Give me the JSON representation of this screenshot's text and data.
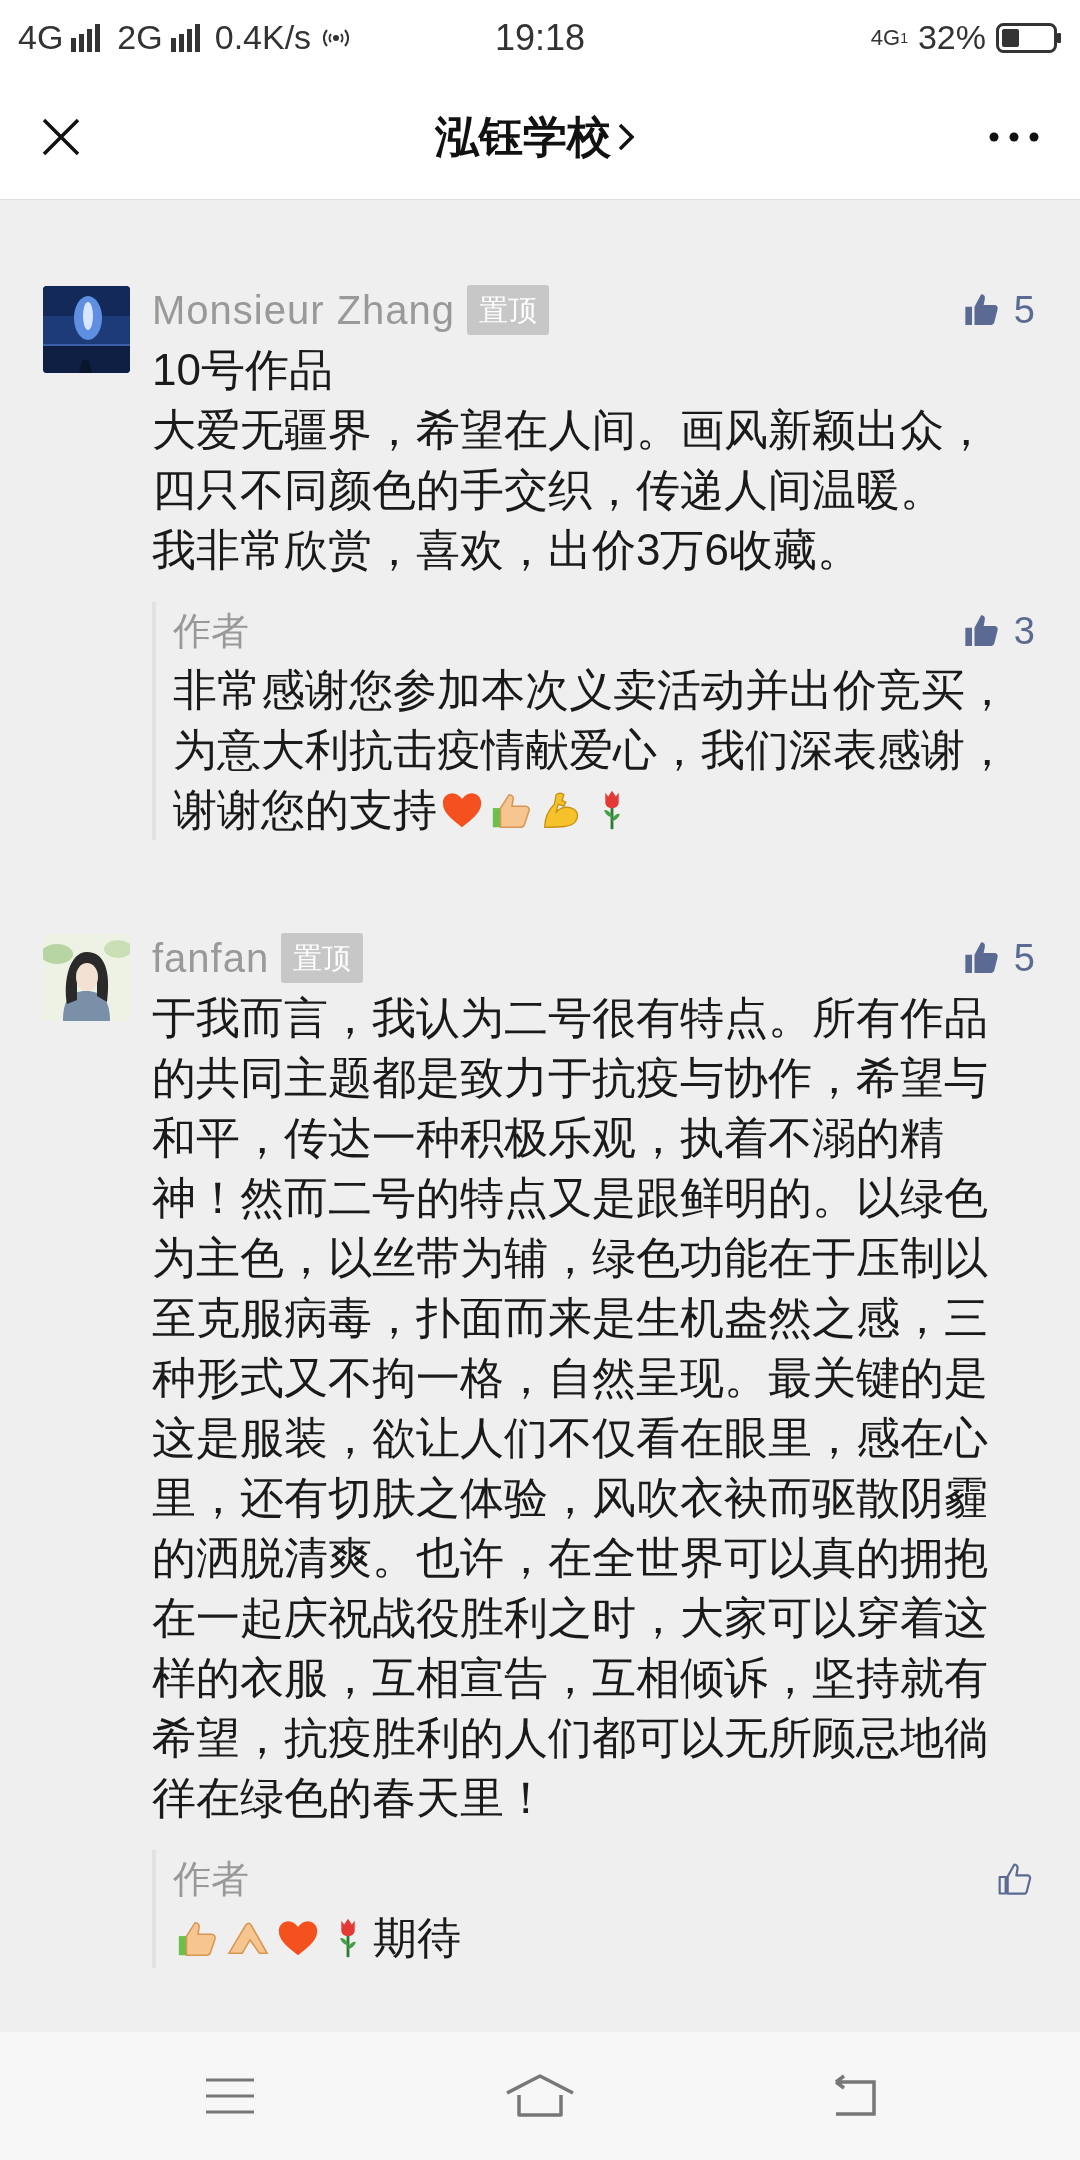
{
  "status_bar": {
    "network_1": "4G",
    "network_2": "2G",
    "speed": "0.4K/s",
    "time": "19:18",
    "network_right": "4G",
    "sim": "1",
    "battery": "32%"
  },
  "nav": {
    "title": "泓钰学校"
  },
  "comments": [
    {
      "name": "Monsieur Zhang",
      "badge": "置顶",
      "likes": "5",
      "liked": true,
      "avatar": {
        "kind": "picture"
      },
      "lines": [
        "10号作品",
        "大爱无疆界，希望在人间。画风新颖出众，",
        "四只不同颜色的手交织，传递人间温暖。",
        "我非常欣赏，喜欢，出价3万6收藏。"
      ],
      "reply": {
        "author": "作者",
        "likes": "3",
        "liked": true,
        "segments": [
          {
            "kind": "text",
            "text": "非常感谢您参加本次义卖活动并出价竞买，为意大利抗击疫情献爱心，我们深表感谢，谢谢您的支持"
          },
          {
            "kind": "heart"
          },
          {
            "kind": "thumbs"
          },
          {
            "kind": "arm"
          },
          {
            "kind": "rose"
          }
        ]
      }
    },
    {
      "name": "fanfan",
      "badge": "置顶",
      "likes": "5",
      "liked": true,
      "avatar": {
        "kind": "picture"
      },
      "lines": [
        "于我而言，我认为二号很有特点。所有作品的共同主题都是致力于抗疫与协作，希望与和平，传达一种积极乐观，执着不溺的精神！然而二号的特点又是跟鲜明的。以绿色为主色，以丝带为辅，绿色功能在于压制以至克服病毒，扑面而来是生机盎然之感，三种形式又不拘一格，自然呈现。最关键的是这是服装，欲让人们不仅看在眼里，感在心里，还有切肤之体验，风吹衣袂而驱散阴霾的洒脱清爽。也许，在全世界可以真的拥抱在一起庆祝战役胜利之时，大家可以穿着这样的衣服，互相宣告，互相倾诉，坚持就有希望，抗疫胜利的人们都可以无所顾忌地徜徉在绿色的春天里！"
      ],
      "reply": {
        "author": "作者",
        "liked": false,
        "segments": [
          {
            "kind": "thumbs"
          },
          {
            "kind": "hands"
          },
          {
            "kind": "heart"
          },
          {
            "kind": "rose"
          },
          {
            "kind": "text",
            "text": "期待"
          }
        ]
      }
    }
  ]
}
